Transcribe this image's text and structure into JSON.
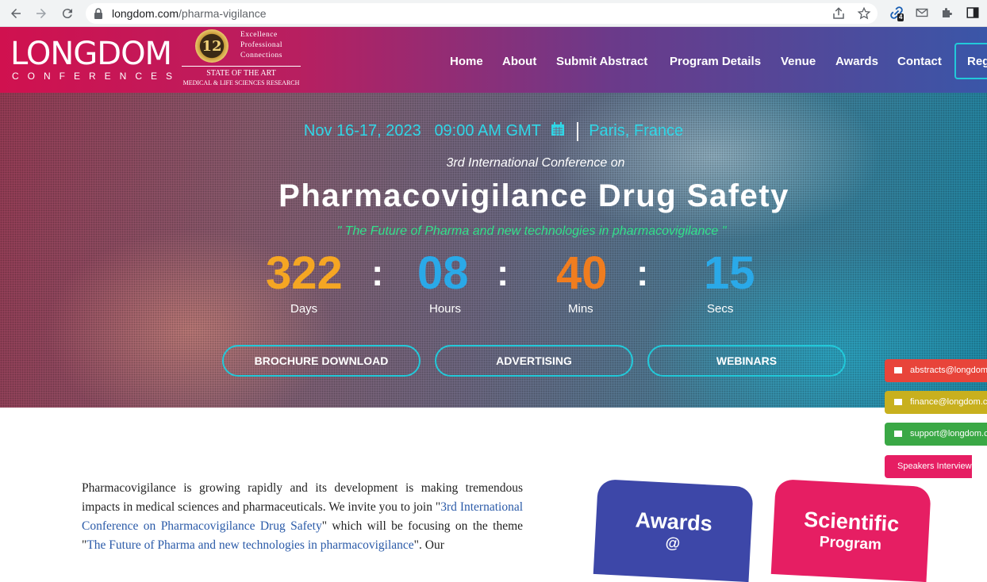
{
  "browser": {
    "url_domain": "longdom.com",
    "url_path": "/pharma-vigilance",
    "extension_badge": "4"
  },
  "header": {
    "logo_main": "LONGDOM",
    "logo_sub": "CONFERENCES",
    "badge_number": "12",
    "tagline_lines": [
      "Excellence",
      "Professional",
      "Connections"
    ],
    "state_line": "STATE OF THE ART",
    "medical_line": "MEDICAL & LIFE SCIENCES RESEARCH"
  },
  "nav": {
    "items": [
      "Home",
      "About",
      "Submit Abstract",
      "Program Details",
      "Venue",
      "Awards",
      "Contact"
    ],
    "register_label": "Reg"
  },
  "hero": {
    "date": "Nov 16-17, 2023",
    "time": "09:00 AM GMT",
    "location": "Paris, France",
    "intro": "3rd International Conference on",
    "title": "Pharmacovigilance Drug Safety",
    "theme": "\" The Future of Pharma and new technologies in pharmacovigilance \"",
    "countdown": {
      "days": "322",
      "days_label": "Days",
      "hours": "08",
      "hours_label": "Hours",
      "mins": "40",
      "mins_label": "Mins",
      "secs": "15",
      "secs_label": "Secs",
      "separator": ":"
    },
    "buttons": [
      "BROCHURE DOWNLOAD",
      "ADVERTISING",
      "WEBINARS"
    ]
  },
  "side_tabs": {
    "abstracts": "abstracts@longdom",
    "finance": "finance@longdom.c",
    "support": "support@longdom.c",
    "speakers": "Speakers Interview"
  },
  "body": {
    "p1": "Pharmacovigilance is growing rapidly and its development is making tremendous impacts in medical sciences and pharmaceuticals. We invite you to join \"",
    "link1": "3rd International Conference on Pharmacovigilance Drug Safety",
    "p2": "\" which will be focusing on the theme \"",
    "link2": "The Future of Pharma and new technologies in pharmacovigilance",
    "p3": "\". Our"
  },
  "cards": {
    "awards_title": "Awards",
    "awards_sub": "@",
    "scientific_title": "Scientific",
    "scientific_sub": "Program"
  },
  "colors": {
    "countdown_days": "#f5a623",
    "countdown_hours": "#2aa9e8",
    "countdown_mins": "#f07d1f",
    "countdown_secs": "#2aa9e8",
    "accent_cyan": "#22c9d9",
    "side_abstracts": "#e8443a",
    "side_finance": "#c8b01e",
    "side_support": "#3aa845",
    "side_speakers": "#e61e63"
  }
}
